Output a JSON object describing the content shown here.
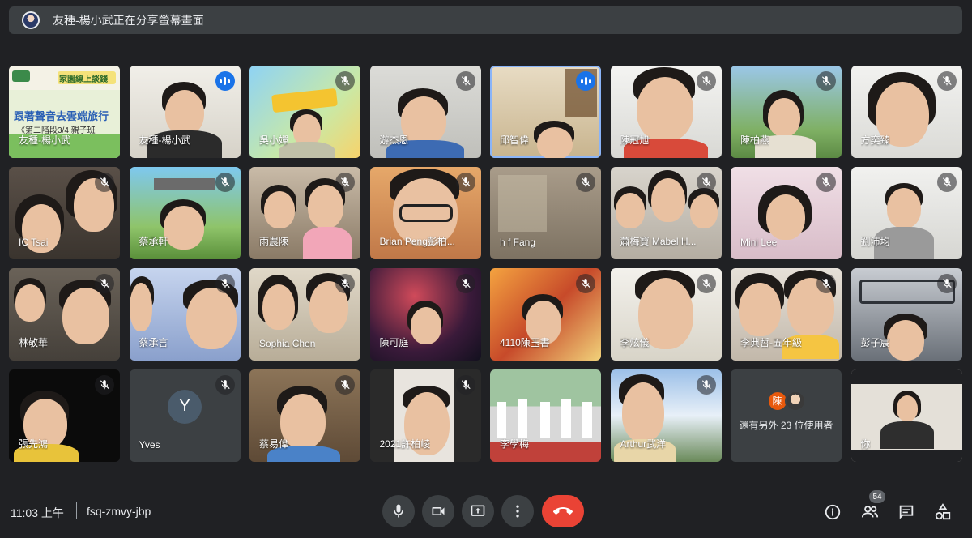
{
  "banner": {
    "text": "友種-楊小武正在分享螢幕畫面"
  },
  "tiles": [
    {
      "name": "友種-楊小武",
      "status": "presenting"
    },
    {
      "name": "友種-楊小武",
      "status": "speaking"
    },
    {
      "name": "吳小嬋",
      "status": "muted"
    },
    {
      "name": "游杰恩",
      "status": "muted"
    },
    {
      "name": "邱智偉",
      "status": "speaking"
    },
    {
      "name": "陳冠旭",
      "status": "muted"
    },
    {
      "name": "陳柏燕",
      "status": "muted"
    },
    {
      "name": "方奕臻",
      "status": "muted"
    },
    {
      "name": "IC Tsai",
      "status": "muted"
    },
    {
      "name": "蔡承軒",
      "status": "muted"
    },
    {
      "name": "雨農陳",
      "status": "muted"
    },
    {
      "name": "Brian Peng彭柏...",
      "status": "muted"
    },
    {
      "name": "h f Fang",
      "status": "muted"
    },
    {
      "name": "蕭梅寶 Mabel H...",
      "status": "muted"
    },
    {
      "name": "Mini Lee",
      "status": "muted"
    },
    {
      "name": "劉沛均",
      "status": "muted"
    },
    {
      "name": "林敬華",
      "status": "muted"
    },
    {
      "name": "蔡承言",
      "status": "muted"
    },
    {
      "name": "Sophia Chen",
      "status": "muted"
    },
    {
      "name": "陳可庭",
      "status": "muted"
    },
    {
      "name": "4110陳玉書",
      "status": "muted"
    },
    {
      "name": "李炫儀",
      "status": "muted"
    },
    {
      "name": "李典哲-五年級",
      "status": "muted"
    },
    {
      "name": "彭子宸",
      "status": "muted"
    },
    {
      "name": "張先鴻",
      "status": "muted"
    },
    {
      "name": "Yves",
      "status": "muted",
      "initial": "Y"
    },
    {
      "name": "蔡易偉",
      "status": "muted"
    },
    {
      "name": "2021許柏崚",
      "status": "muted"
    },
    {
      "name": "李學梅",
      "status": "muted"
    },
    {
      "name": "Arthur武洋",
      "status": "muted"
    },
    {
      "name": "",
      "status": "none"
    },
    {
      "name": "你",
      "status": "none"
    }
  ],
  "presentation": {
    "line1": "跟著聲音去雲端旅行",
    "line2": "《第二階段3/4 親子班",
    "badge": "家園線上談錢"
  },
  "others": {
    "label": "還有另外 23 位使用者",
    "avatar_initial": "陳"
  },
  "bottom": {
    "time": "11:03 上午",
    "meeting_code": "fsq-zmvy-jbp",
    "participant_count": "54"
  },
  "icons": {
    "mic": "microphone-icon",
    "camera": "camera-icon",
    "present": "present-screen-icon",
    "more": "more-vertical-icon",
    "end": "end-call-icon",
    "info": "info-icon",
    "people": "people-icon",
    "chat": "chat-icon",
    "activities": "activities-icon"
  },
  "colors": {
    "end_call": "#ea4335",
    "speaking": "#1a73e8",
    "background": "#202124",
    "tile": "#3c4043"
  }
}
